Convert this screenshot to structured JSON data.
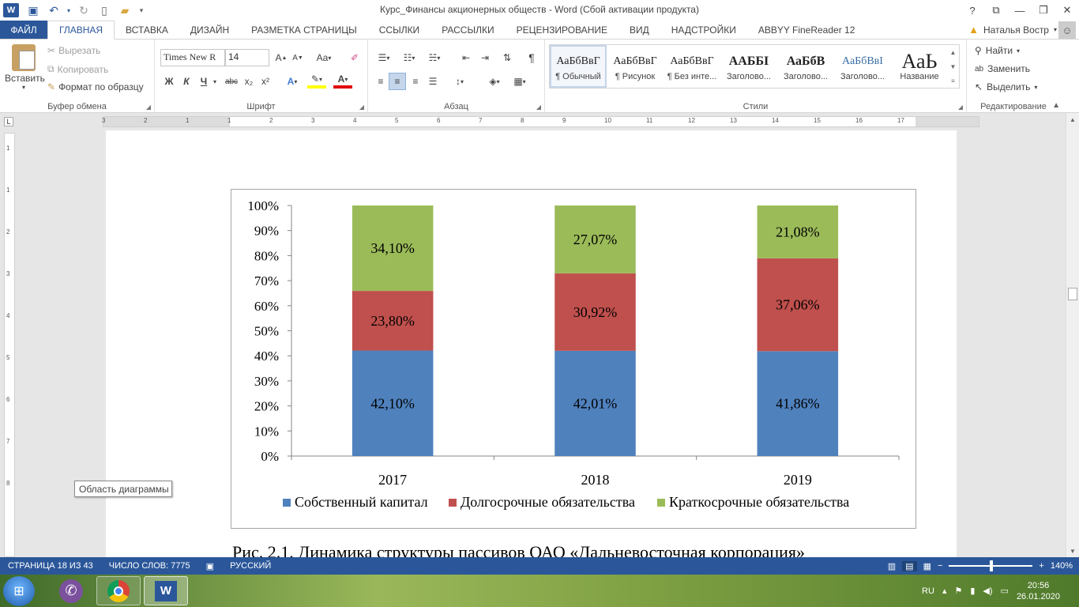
{
  "window": {
    "title": "Курс_Финансы акционерных обществ - Word (Сбой активации продукта)",
    "help": "?",
    "controls": [
      "restore-ribbon",
      "minimize",
      "maximize",
      "close"
    ]
  },
  "tabs": [
    {
      "label": "ФАЙЛ"
    },
    {
      "label": "ГЛАВНАЯ"
    },
    {
      "label": "ВСТАВКА"
    },
    {
      "label": "ДИЗАЙН"
    },
    {
      "label": "РАЗМЕТКА СТРАНИЦЫ"
    },
    {
      "label": "ССЫЛКИ"
    },
    {
      "label": "РАССЫЛКИ"
    },
    {
      "label": "РЕЦЕНЗИРОВАНИЕ"
    },
    {
      "label": "ВИД"
    },
    {
      "label": "НАДСТРОЙКИ"
    },
    {
      "label": "ABBYY FineReader 12"
    }
  ],
  "user": {
    "name": "Наталья Востр"
  },
  "ribbon": {
    "clipboard": {
      "paste": "Вставить",
      "cut": "Вырезать",
      "copy": "Копировать",
      "format_painter": "Формат по образцу",
      "label": "Буфер обмена"
    },
    "font": {
      "name": "Times New R",
      "size": "14",
      "label": "Шрифт",
      "bold": "Ж",
      "italic": "К",
      "underline": "Ч",
      "strike": "abc",
      "sub": "x₂",
      "sup": "x²",
      "case": "Aa"
    },
    "paragraph": {
      "label": "Абзац"
    },
    "styles": {
      "label": "Стили",
      "items": [
        {
          "sample": "АаБбВвГ",
          "name": "¶ Обычный"
        },
        {
          "sample": "АаБбВвГ",
          "name": "¶ Рисунок"
        },
        {
          "sample": "АаБбВвГ",
          "name": "¶ Без инте..."
        },
        {
          "sample": "ААББІ",
          "name": "Заголово..."
        },
        {
          "sample": "АаБбВ",
          "name": "Заголово..."
        },
        {
          "sample": "АаБбВвІ",
          "name": "Заголово..."
        },
        {
          "sample": "АаЬ",
          "name": "Название"
        }
      ]
    },
    "editing": {
      "label": "Редактирование",
      "find": "Найти",
      "replace": "Заменить",
      "select": "Выделить"
    }
  },
  "rulers": {
    "horizontal": [
      "3",
      "2",
      "1",
      "1",
      "2",
      "3",
      "4",
      "5",
      "6",
      "7",
      "8",
      "9",
      "10",
      "11",
      "12",
      "13",
      "14",
      "15",
      "16",
      "17"
    ],
    "vertical": [
      "1",
      "1",
      "2",
      "3",
      "4",
      "5",
      "6",
      "7",
      "8"
    ],
    "corner": "L"
  },
  "chart_data": {
    "type": "bar",
    "stacked": true,
    "categories": [
      "2017",
      "2018",
      "2019"
    ],
    "series": [
      {
        "name": "Собственный капитал",
        "color": "#4f81bd",
        "values": [
          42.1,
          42.01,
          41.86
        ],
        "labels": [
          "42,10%",
          "42,01%",
          "41,86%"
        ]
      },
      {
        "name": "Долгосрочные обязательства",
        "color": "#c0504d",
        "values": [
          23.8,
          30.92,
          37.06
        ],
        "labels": [
          "23,80%",
          "30,92%",
          "37,06%"
        ]
      },
      {
        "name": "Краткосрочные обязательства",
        "color": "#9bbb59",
        "values": [
          34.1,
          27.07,
          21.08
        ],
        "labels": [
          "34,10%",
          "27,07%",
          "21,08%"
        ]
      }
    ],
    "yticks": [
      "0%",
      "10%",
      "20%",
      "30%",
      "40%",
      "50%",
      "60%",
      "70%",
      "80%",
      "90%",
      "100%"
    ],
    "ylim": [
      0,
      100
    ],
    "legend": "bottom"
  },
  "document": {
    "caption": "Рис. 2.1. Динамика структуры пассивов ОАО «Дальневосточная корпорация»",
    "tooltip": "Область диаграммы"
  },
  "status": {
    "page": "СТРАНИЦА 18 ИЗ 43",
    "words": "ЧИСЛО СЛОВ: 7775",
    "language": "РУССКИЙ",
    "zoom": "140%",
    "zoom_minus": "−",
    "zoom_plus": "+"
  },
  "taskbar": {
    "lang": "RU",
    "time": "20:56",
    "date": "26.01.2020"
  }
}
